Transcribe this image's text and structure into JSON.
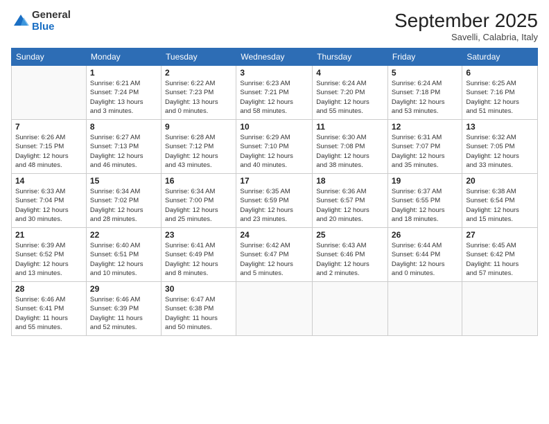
{
  "logo": {
    "general": "General",
    "blue": "Blue"
  },
  "header": {
    "month": "September 2025",
    "location": "Savelli, Calabria, Italy"
  },
  "days_of_week": [
    "Sunday",
    "Monday",
    "Tuesday",
    "Wednesday",
    "Thursday",
    "Friday",
    "Saturday"
  ],
  "weeks": [
    [
      {
        "day": "",
        "info": ""
      },
      {
        "day": "1",
        "info": "Sunrise: 6:21 AM\nSunset: 7:24 PM\nDaylight: 13 hours\nand 3 minutes."
      },
      {
        "day": "2",
        "info": "Sunrise: 6:22 AM\nSunset: 7:23 PM\nDaylight: 13 hours\nand 0 minutes."
      },
      {
        "day": "3",
        "info": "Sunrise: 6:23 AM\nSunset: 7:21 PM\nDaylight: 12 hours\nand 58 minutes."
      },
      {
        "day": "4",
        "info": "Sunrise: 6:24 AM\nSunset: 7:20 PM\nDaylight: 12 hours\nand 55 minutes."
      },
      {
        "day": "5",
        "info": "Sunrise: 6:24 AM\nSunset: 7:18 PM\nDaylight: 12 hours\nand 53 minutes."
      },
      {
        "day": "6",
        "info": "Sunrise: 6:25 AM\nSunset: 7:16 PM\nDaylight: 12 hours\nand 51 minutes."
      }
    ],
    [
      {
        "day": "7",
        "info": "Sunrise: 6:26 AM\nSunset: 7:15 PM\nDaylight: 12 hours\nand 48 minutes."
      },
      {
        "day": "8",
        "info": "Sunrise: 6:27 AM\nSunset: 7:13 PM\nDaylight: 12 hours\nand 46 minutes."
      },
      {
        "day": "9",
        "info": "Sunrise: 6:28 AM\nSunset: 7:12 PM\nDaylight: 12 hours\nand 43 minutes."
      },
      {
        "day": "10",
        "info": "Sunrise: 6:29 AM\nSunset: 7:10 PM\nDaylight: 12 hours\nand 40 minutes."
      },
      {
        "day": "11",
        "info": "Sunrise: 6:30 AM\nSunset: 7:08 PM\nDaylight: 12 hours\nand 38 minutes."
      },
      {
        "day": "12",
        "info": "Sunrise: 6:31 AM\nSunset: 7:07 PM\nDaylight: 12 hours\nand 35 minutes."
      },
      {
        "day": "13",
        "info": "Sunrise: 6:32 AM\nSunset: 7:05 PM\nDaylight: 12 hours\nand 33 minutes."
      }
    ],
    [
      {
        "day": "14",
        "info": "Sunrise: 6:33 AM\nSunset: 7:04 PM\nDaylight: 12 hours\nand 30 minutes."
      },
      {
        "day": "15",
        "info": "Sunrise: 6:34 AM\nSunset: 7:02 PM\nDaylight: 12 hours\nand 28 minutes."
      },
      {
        "day": "16",
        "info": "Sunrise: 6:34 AM\nSunset: 7:00 PM\nDaylight: 12 hours\nand 25 minutes."
      },
      {
        "day": "17",
        "info": "Sunrise: 6:35 AM\nSunset: 6:59 PM\nDaylight: 12 hours\nand 23 minutes."
      },
      {
        "day": "18",
        "info": "Sunrise: 6:36 AM\nSunset: 6:57 PM\nDaylight: 12 hours\nand 20 minutes."
      },
      {
        "day": "19",
        "info": "Sunrise: 6:37 AM\nSunset: 6:55 PM\nDaylight: 12 hours\nand 18 minutes."
      },
      {
        "day": "20",
        "info": "Sunrise: 6:38 AM\nSunset: 6:54 PM\nDaylight: 12 hours\nand 15 minutes."
      }
    ],
    [
      {
        "day": "21",
        "info": "Sunrise: 6:39 AM\nSunset: 6:52 PM\nDaylight: 12 hours\nand 13 minutes."
      },
      {
        "day": "22",
        "info": "Sunrise: 6:40 AM\nSunset: 6:51 PM\nDaylight: 12 hours\nand 10 minutes."
      },
      {
        "day": "23",
        "info": "Sunrise: 6:41 AM\nSunset: 6:49 PM\nDaylight: 12 hours\nand 8 minutes."
      },
      {
        "day": "24",
        "info": "Sunrise: 6:42 AM\nSunset: 6:47 PM\nDaylight: 12 hours\nand 5 minutes."
      },
      {
        "day": "25",
        "info": "Sunrise: 6:43 AM\nSunset: 6:46 PM\nDaylight: 12 hours\nand 2 minutes."
      },
      {
        "day": "26",
        "info": "Sunrise: 6:44 AM\nSunset: 6:44 PM\nDaylight: 12 hours\nand 0 minutes."
      },
      {
        "day": "27",
        "info": "Sunrise: 6:45 AM\nSunset: 6:42 PM\nDaylight: 11 hours\nand 57 minutes."
      }
    ],
    [
      {
        "day": "28",
        "info": "Sunrise: 6:46 AM\nSunset: 6:41 PM\nDaylight: 11 hours\nand 55 minutes."
      },
      {
        "day": "29",
        "info": "Sunrise: 6:46 AM\nSunset: 6:39 PM\nDaylight: 11 hours\nand 52 minutes."
      },
      {
        "day": "30",
        "info": "Sunrise: 6:47 AM\nSunset: 6:38 PM\nDaylight: 11 hours\nand 50 minutes."
      },
      {
        "day": "",
        "info": ""
      },
      {
        "day": "",
        "info": ""
      },
      {
        "day": "",
        "info": ""
      },
      {
        "day": "",
        "info": ""
      }
    ]
  ]
}
